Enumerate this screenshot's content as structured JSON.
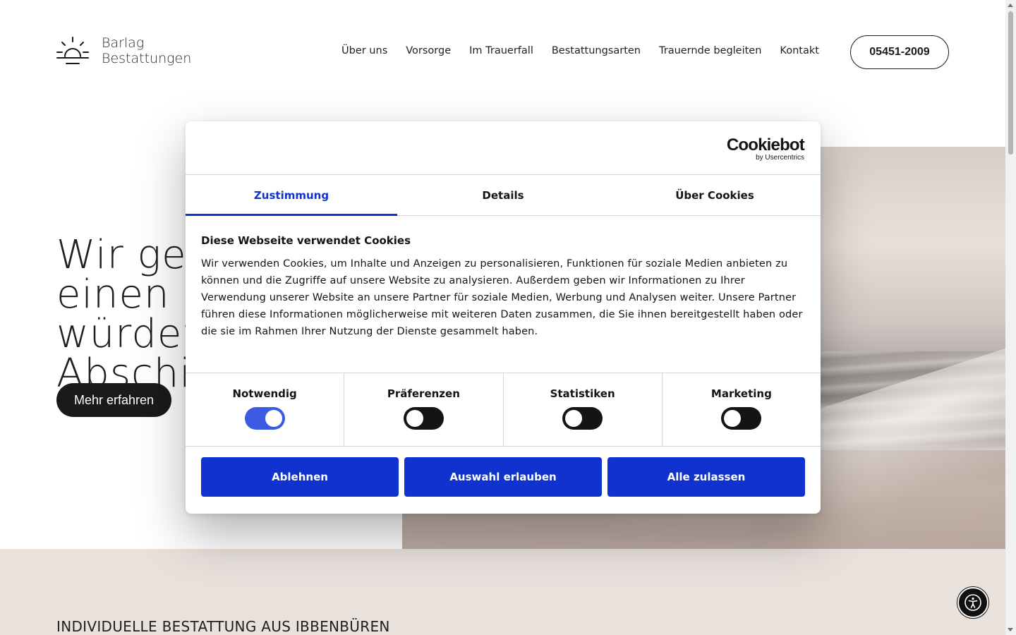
{
  "header": {
    "logo_line1": "Barlag",
    "logo_line2": "Bestattungen",
    "nav": [
      "Über uns",
      "Vorsorge",
      "Im Trauerfall",
      "Bestattungsarten",
      "Trauernde begleiten",
      "Kontakt"
    ],
    "phone": "05451-2009"
  },
  "hero": {
    "title": "Wir gestalten\neinen würdevollen\nAbschied",
    "cta": "Mehr erfahren"
  },
  "section": {
    "title": "INDIVIDUELLE BESTATTUNG AUS IBBENBÜREN"
  },
  "cookie": {
    "brand": "Cookiebot",
    "brand_sub": "by Usercentrics",
    "tabs": [
      "Zustimmung",
      "Details",
      "Über Cookies"
    ],
    "active_tab": "Zustimmung",
    "heading": "Diese Webseite verwendet Cookies",
    "text": "Wir verwenden Cookies, um Inhalte und Anzeigen zu personalisieren, Funktionen für soziale Medien anbieten zu können und die Zugriffe auf unsere Website zu analysieren. Außerdem geben wir Informationen zu Ihrer Verwendung unserer Website an unsere Partner für soziale Medien, Werbung und Analysen weiter. Unsere Partner führen diese Informationen möglicherweise mit weiteren Daten zusammen, die Sie ihnen bereitgestellt haben oder die sie im Rahmen Ihrer Nutzung der Dienste gesammelt haben.",
    "toggles": [
      {
        "label": "Notwendig",
        "on": true
      },
      {
        "label": "Präferenzen",
        "on": false
      },
      {
        "label": "Statistiken",
        "on": false
      },
      {
        "label": "Marketing",
        "on": false
      }
    ],
    "buttons": {
      "deny": "Ablehnen",
      "allow_selection": "Auswahl erlauben",
      "allow_all": "Alle zulassen"
    },
    "accent_color": "#1032cf"
  },
  "icons": {
    "logo": "sunrise-icon",
    "accessibility": "accessibility-icon"
  }
}
